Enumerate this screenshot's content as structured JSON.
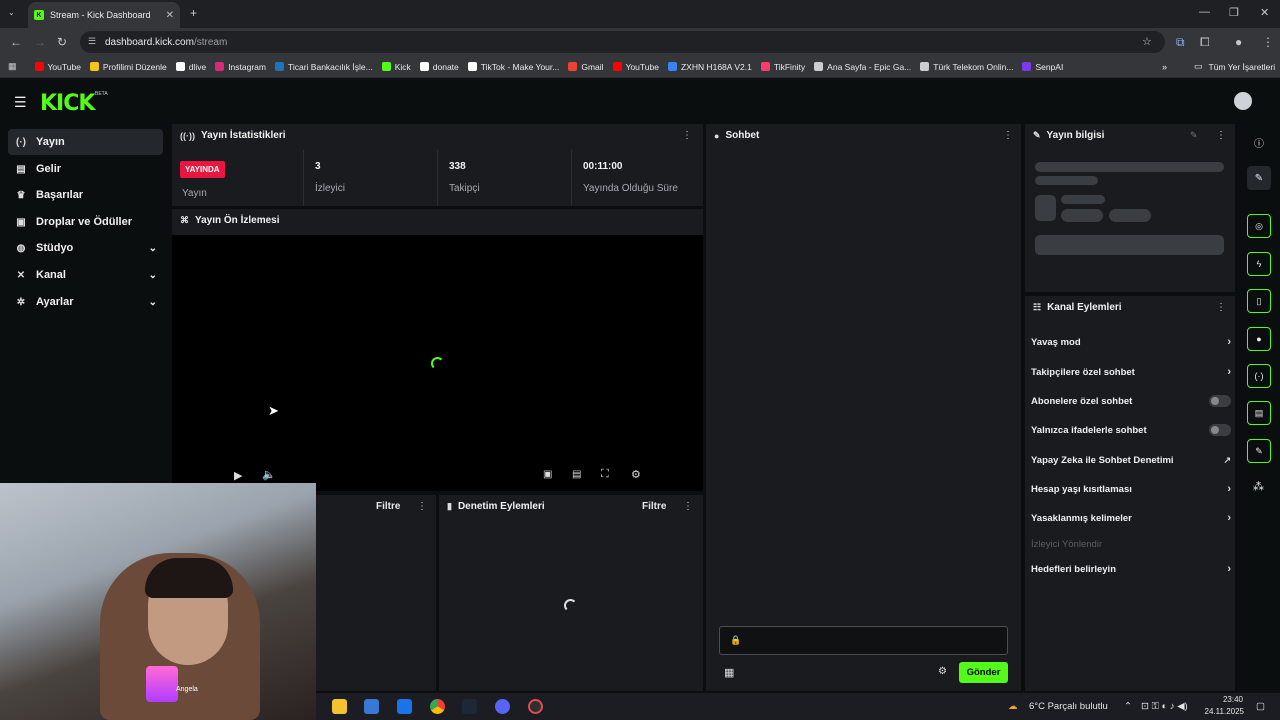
{
  "browser": {
    "tab_title": "Stream - Kick Dashboard",
    "tab_favicon_letter": "K",
    "url_host": "dashboard.kick.com",
    "url_path": "/stream",
    "bookmarks": [
      {
        "label": "YouTube",
        "color": "#ff0000"
      },
      {
        "label": "Profilimi Düzenle",
        "color": "#f5c518"
      },
      {
        "label": "dlive",
        "color": "#ffffff"
      },
      {
        "label": "Instagram",
        "color": "#d62976"
      },
      {
        "label": "Ticari Bankacılık İşle...",
        "color": "#1b75bc"
      },
      {
        "label": "Kick",
        "color": "#53fc18"
      },
      {
        "label": "donate",
        "color": "#ffffff"
      },
      {
        "label": "TikTok - Make Your...",
        "color": "#ffffff"
      },
      {
        "label": "Gmail",
        "color": "#ea4335"
      },
      {
        "label": "YouTube",
        "color": "#ff0000"
      },
      {
        "label": "ZXHN H168A V2.1",
        "color": "#3b82f6"
      },
      {
        "label": "TikFinity",
        "color": "#ff3b6b"
      },
      {
        "label": "Ana Sayfa - Epic Ga...",
        "color": "#cccccc"
      },
      {
        "label": "Türk Telekom Onlin...",
        "color": "#cccccc"
      },
      {
        "label": "SenpAI",
        "color": "#7c3aed"
      }
    ],
    "all_bookmarks_label": "Tüm Yer İşaretleri"
  },
  "header": {
    "logo": "KICK",
    "beta": "BETA"
  },
  "sidebar": {
    "items": [
      {
        "label": "Yayın",
        "icon": "broadcast-icon",
        "glyph": "(·)"
      },
      {
        "label": "Gelir",
        "icon": "wallet-icon",
        "glyph": "▤"
      },
      {
        "label": "Başarılar",
        "icon": "trophy-icon",
        "glyph": "♛"
      },
      {
        "label": "Droplar ve Ödüller",
        "icon": "gift-icon",
        "glyph": "▣"
      },
      {
        "label": "Stüdyo",
        "icon": "palette-icon",
        "glyph": "◍"
      },
      {
        "label": "Kanal",
        "icon": "tools-icon",
        "glyph": "✕"
      },
      {
        "label": "Ayarlar",
        "icon": "gear-icon",
        "glyph": "✲"
      }
    ]
  },
  "stats_panel": {
    "title": "Yayın İstatistikleri",
    "live_badge": "YAYINDA",
    "live_label": "Yayın",
    "viewers_value": "3",
    "viewers_label": "İzleyici",
    "followers_value": "338",
    "followers_label": "Takipçi",
    "uptime_value": "00:11:00",
    "uptime_label": "Yayında Olduğu Süre"
  },
  "preview_panel": {
    "title": "Yayın Ön İzlemesi"
  },
  "lower_panels": {
    "left_filter": "Filtre",
    "mod_title": "Denetim Eylemleri",
    "mod_filter": "Filtre"
  },
  "chat": {
    "title": "Sohbet",
    "send_label": "Gönder"
  },
  "stream_info": {
    "title": "Yayın bilgisi"
  },
  "channel_actions": {
    "title": "Kanal Eylemleri",
    "rows": [
      {
        "label": "Yavaş mod",
        "kind": "arrow"
      },
      {
        "label": "Takipçilere özel sohbet",
        "kind": "arrow"
      },
      {
        "label": "Abonelere özel sohbet",
        "kind": "toggle",
        "on": false
      },
      {
        "label": "Yalnızca ifadelerle sohbet",
        "kind": "toggle",
        "on": false
      },
      {
        "label": "Yapay Zeka ile Sohbet Denetimi",
        "kind": "external"
      },
      {
        "label": "Hesap yaşı kısıtlaması",
        "kind": "arrow"
      },
      {
        "label": "Yasaklanmış kelimeler",
        "kind": "arrow"
      },
      {
        "label": "İzleyici Yönlendir",
        "kind": "disabled"
      },
      {
        "label": "Hedefleri belirleyin",
        "kind": "arrow"
      }
    ]
  },
  "webcam": {
    "overlay_text": "Angela"
  },
  "taskbar": {
    "weather": "6°C  Parçalı bulutlu",
    "time": "23:40",
    "date": "24.11.2025"
  }
}
